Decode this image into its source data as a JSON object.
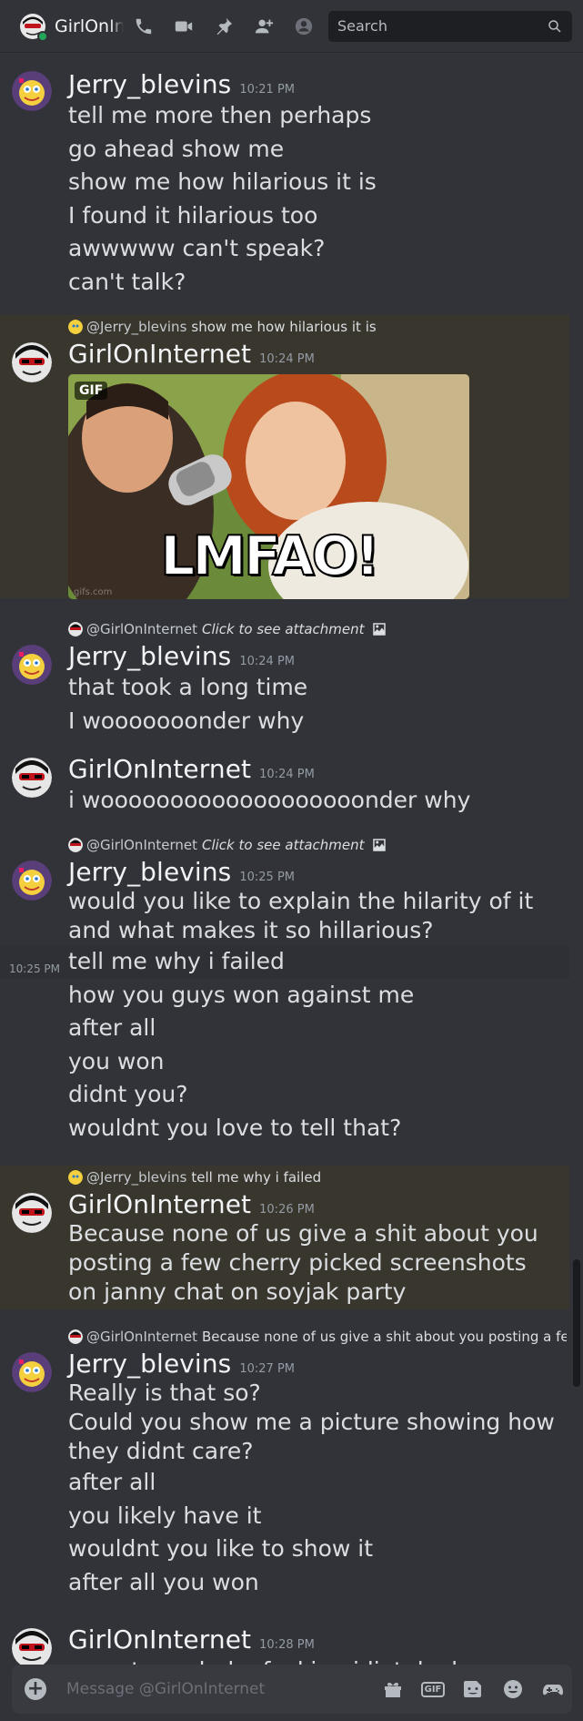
{
  "header": {
    "channel_name": "GirlOnInternet",
    "search_placeholder": "Search",
    "icons": [
      "phone-icon",
      "video-icon",
      "pin-icon",
      "add-friend-icon",
      "profile-icon",
      "search-icon"
    ]
  },
  "messages": [
    {
      "author": "Jerry_blevins",
      "time": "10:21 PM",
      "lines": [
        "tell me more then perhaps",
        "go ahead show me",
        "show me how hilarious it is",
        "I found it hilarious too",
        "awwwww can't speak?",
        "can't talk?"
      ]
    },
    {
      "reply": {
        "mention": "@Jerry_blevins",
        "text": "show me how hilarious it is"
      },
      "author": "GirlOnInternet",
      "time": "10:24 PM",
      "gif": {
        "badge": "GIF",
        "caption": "LMFAO!",
        "watermark": "gifs.com"
      }
    },
    {
      "reply": {
        "mention": "@GirlOnInternet",
        "italic": "Click to see attachment"
      },
      "author": "Jerry_blevins",
      "time": "10:24 PM",
      "lines": [
        "that took a long time",
        "I wooooooonder why"
      ]
    },
    {
      "author": "GirlOnInternet",
      "time": "10:24 PM",
      "lines": [
        "i wooooooooooooooooooonder why"
      ]
    },
    {
      "reply": {
        "mention": "@GirlOnInternet",
        "italic": "Click to see attachment"
      },
      "author": "Jerry_blevins",
      "time": "10:25 PM",
      "lines_tight": [
        "would you like to explain the hilarity of it",
        "and what makes it so hillarious?"
      ],
      "hover_line": {
        "time": "10:25 PM",
        "text": "tell me why i failed"
      },
      "lines": [
        "how you guys won against me",
        "after all",
        "you won",
        "didnt you?",
        "wouldnt you love to tell that?"
      ]
    },
    {
      "reply": {
        "mention": "@Jerry_blevins",
        "text": "tell me why i failed"
      },
      "author": "GirlOnInternet",
      "time": "10:26 PM",
      "lines_tight": [
        "Because none of us give a shit about you",
        "posting a few cherry picked screenshots",
        "on janny chat on soyjak party"
      ]
    },
    {
      "reply": {
        "mention": "@GirlOnInternet",
        "text": "Because none of us give a shit about you posting a few ch..."
      },
      "author": "Jerry_blevins",
      "time": "10:27 PM",
      "lines_tight": [
        "Really is that so?",
        "Could you show me a picture showing how",
        "they didnt care?"
      ],
      "lines": [
        "after all",
        "you likely have it",
        "wouldnt you like to show it",
        "after all you won"
      ]
    },
    {
      "author": "GirlOnInternet",
      "time": "10:28 PM",
      "lines": [
        "ya got me dude, fucking idiot. looks"
      ]
    }
  ],
  "composer": {
    "placeholder": "Message @GirlOnInternet",
    "gif_label": "GIF",
    "icons": [
      "add-icon",
      "gift-icon",
      "gif-icon",
      "sticker-icon",
      "emoji-icon",
      "game-icon"
    ]
  }
}
